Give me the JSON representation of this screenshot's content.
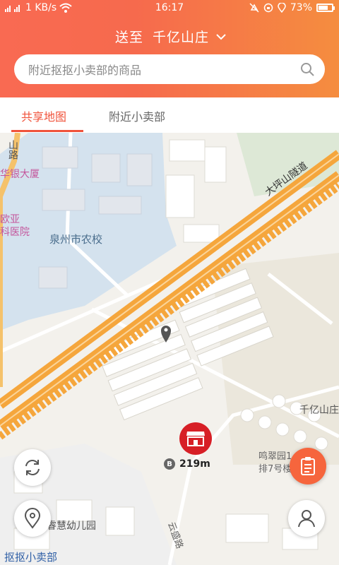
{
  "status_bar": {
    "network": "1 KB/s",
    "time": "16:17",
    "battery": "73%",
    "battery_level": 0.73
  },
  "header": {
    "deliver_prefix": "送至",
    "location": "千亿山庄"
  },
  "search": {
    "placeholder": "附近抠抠小卖部的商品"
  },
  "tabs": [
    {
      "label": "共享地图",
      "active": true
    },
    {
      "label": "附近小卖部",
      "active": false
    }
  ],
  "map": {
    "labels": {
      "road_top": "大坪山隧道",
      "road_left": "山路",
      "bank": "华银大厦",
      "hospital_1": "欧亚",
      "hospital_2": "科医院",
      "school": "泉州市农校",
      "area": "千亿山庄",
      "garden_1": "鸣翠园1",
      "garden_2": "排7号楼",
      "kinder": "睿慧幼儿园",
      "street": "云盛路",
      "brand": "抠抠小卖部"
    },
    "shop_distance": "219m"
  },
  "colors": {
    "accent": "#f0533b",
    "marker": "#d71f26",
    "highway": "#f5a63c",
    "water": "#d4e2ee"
  }
}
